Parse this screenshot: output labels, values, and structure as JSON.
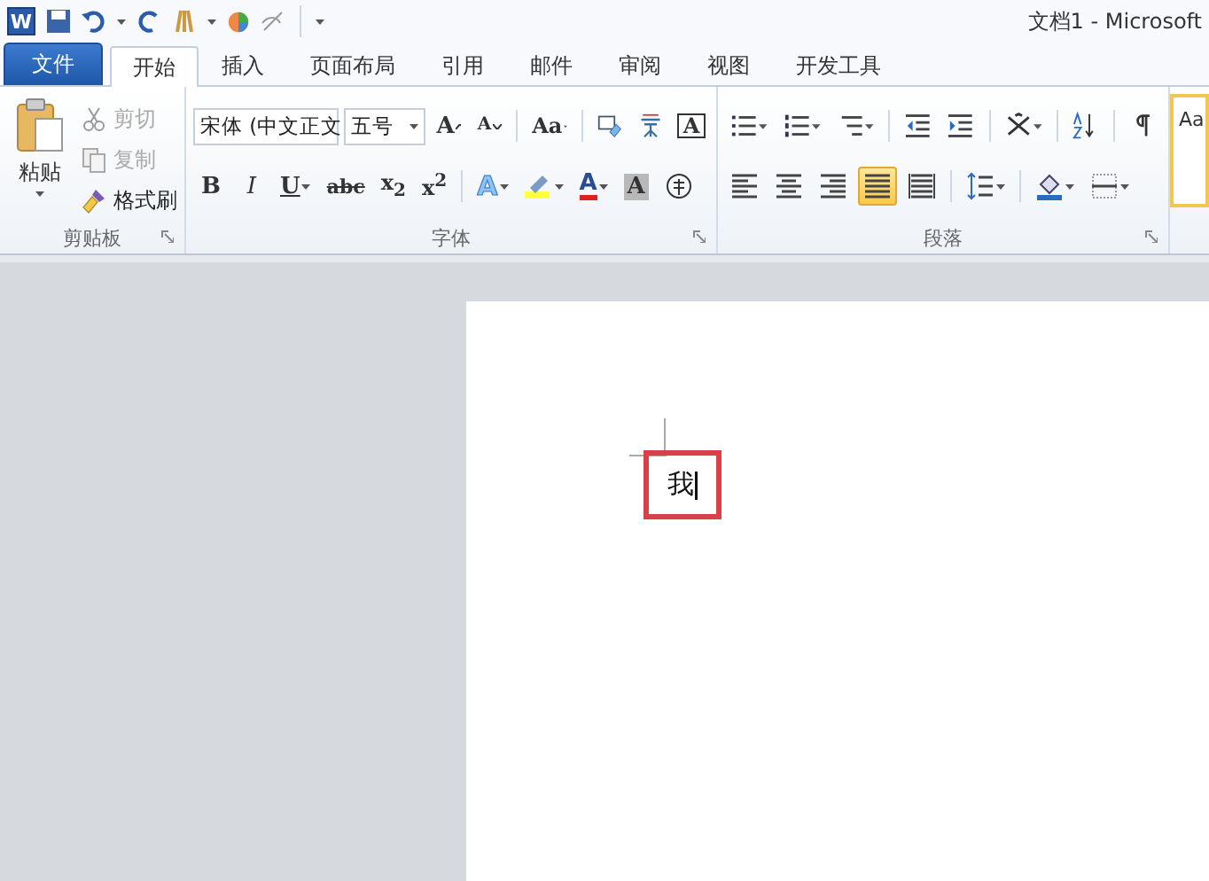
{
  "app_icon": "W",
  "window": {
    "title": "文档1  -  Microsoft"
  },
  "tabs": [
    {
      "label": "文件",
      "kind": "file",
      "selected": false
    },
    {
      "label": "开始",
      "kind": "tab",
      "selected": true
    },
    {
      "label": "插入",
      "kind": "tab",
      "selected": false
    },
    {
      "label": "页面布局",
      "kind": "tab",
      "selected": false
    },
    {
      "label": "引用",
      "kind": "tab",
      "selected": false
    },
    {
      "label": "邮件",
      "kind": "tab",
      "selected": false
    },
    {
      "label": "审阅",
      "kind": "tab",
      "selected": false
    },
    {
      "label": "视图",
      "kind": "tab",
      "selected": false
    },
    {
      "label": "开发工具",
      "kind": "tab",
      "selected": false
    }
  ],
  "clipboard": {
    "paste": "粘贴",
    "group_label": "剪贴板",
    "items": [
      {
        "label": "剪切",
        "kind": "cut",
        "disabled": true
      },
      {
        "label": "复制",
        "kind": "copy",
        "disabled": true
      },
      {
        "label": "格式刷",
        "kind": "brush",
        "disabled": false
      }
    ]
  },
  "font": {
    "font_name": "宋体 (中文正文",
    "font_size": "五号",
    "group_label": "字体",
    "row_1": [
      {
        "kind": "grow",
        "label": "A"
      },
      {
        "kind": "shrink",
        "label": "A"
      },
      {
        "kind": "sep"
      },
      {
        "kind": "case",
        "label": "Aa"
      },
      {
        "kind": "sep"
      },
      {
        "kind": "clear"
      },
      {
        "kind": "phonetic"
      },
      {
        "kind": "boxed",
        "label": "A"
      }
    ],
    "row_2": [
      {
        "kind": "bold",
        "label": "B"
      },
      {
        "kind": "italic",
        "label": "I"
      },
      {
        "kind": "underline",
        "label": "U"
      },
      {
        "kind": "strike",
        "label": "abc"
      },
      {
        "kind": "sub",
        "label": "x$_{2}$"
      },
      {
        "kind": "super",
        "label": "x$^{2}$"
      },
      {
        "kind": "sep"
      },
      {
        "kind": "effects",
        "label": "A"
      },
      {
        "kind": "highlight"
      },
      {
        "kind": "color",
        "label": "A"
      },
      {
        "kind": "shaded",
        "label": "A"
      },
      {
        "kind": "enclose"
      }
    ]
  },
  "paragraph": {
    "group_label": "段落",
    "row_1": [
      {
        "kind": "bullets"
      },
      {
        "kind": "numbering"
      },
      {
        "kind": "multilevel"
      },
      {
        "kind": "sep"
      },
      {
        "kind": "outdent"
      },
      {
        "kind": "indent"
      },
      {
        "kind": "sep"
      },
      {
        "kind": "layout"
      },
      {
        "kind": "sep"
      },
      {
        "kind": "sort"
      },
      {
        "kind": "sep"
      },
      {
        "kind": "marks"
      }
    ],
    "row_2": [
      {
        "kind": "align-left",
        "selected": false
      },
      {
        "kind": "align-center",
        "selected": false
      },
      {
        "kind": "align-right",
        "selected": false
      },
      {
        "kind": "justify",
        "selected": true
      },
      {
        "kind": "distribute",
        "selected": false
      },
      {
        "kind": "sep"
      },
      {
        "kind": "spacing"
      },
      {
        "kind": "sep"
      },
      {
        "kind": "shading"
      },
      {
        "kind": "borders"
      }
    ]
  },
  "styles": {
    "preview": "Aa"
  },
  "document": {
    "text": "我"
  }
}
